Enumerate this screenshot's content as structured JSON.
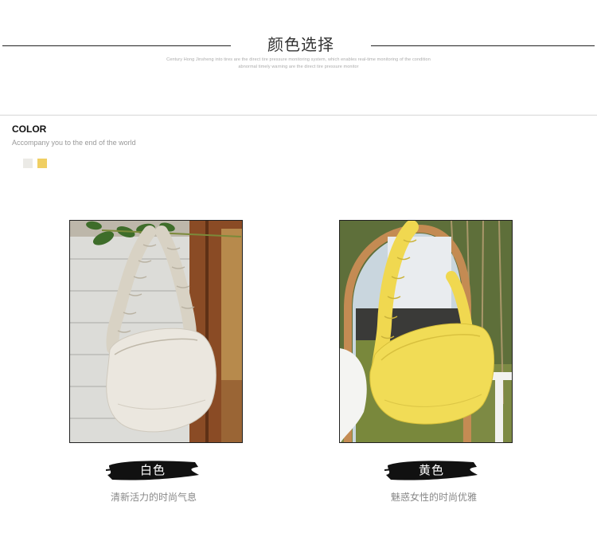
{
  "header": {
    "title": "颜色选择",
    "subtitle_line1": "Century Hong Jinsheng into tires are the direct tire pressure monitoring system, which enables real-time monitoring of the condition",
    "subtitle_line2": "abnormal timely warning are the direct tire pressure monitor"
  },
  "color_section": {
    "title": "COLOR",
    "subtitle": "Accompany you to the end of the world",
    "swatches": [
      {
        "name": "white",
        "color": "#ebeae6"
      },
      {
        "name": "yellow",
        "color": "#f0cf63"
      }
    ]
  },
  "products": [
    {
      "label": "白色",
      "caption": "清新活力的时尚气息",
      "bag_color": "#ebe7df"
    },
    {
      "label": "黄色",
      "caption": "魅惑女性的时尚优雅",
      "bag_color": "#f1dc56"
    }
  ]
}
